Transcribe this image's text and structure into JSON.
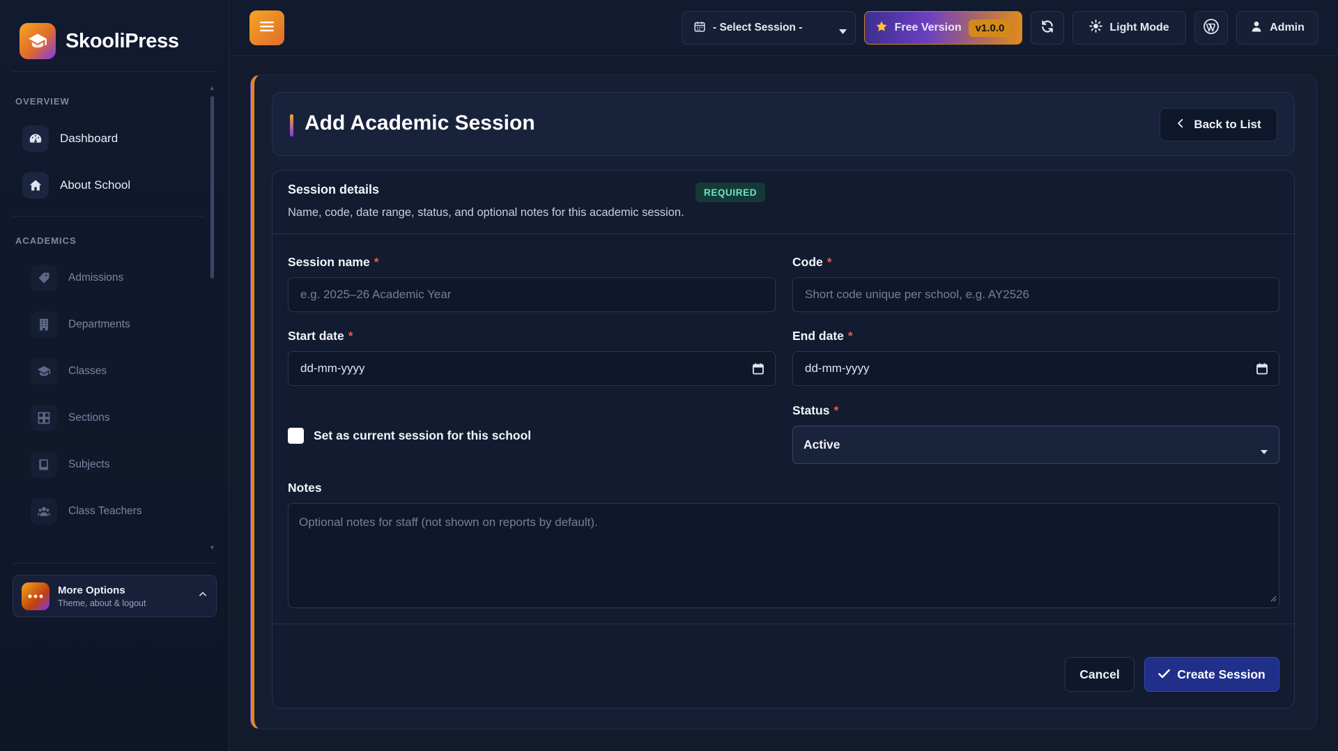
{
  "brand": {
    "name": "SkooliPress",
    "logo_icon": "graduation-cap-icon"
  },
  "sidebar": {
    "sections": [
      {
        "label": "OVERVIEW",
        "items": [
          {
            "label": "Dashboard",
            "icon": "gauge-icon"
          },
          {
            "label": "About School",
            "icon": "home-icon"
          }
        ]
      },
      {
        "label": "ACADEMICS",
        "items": [
          {
            "label": "Admissions",
            "icon": "tag-icon"
          },
          {
            "label": "Departments",
            "icon": "building-icon"
          },
          {
            "label": "Classes",
            "icon": "graduation-cap-icon"
          },
          {
            "label": "Sections",
            "icon": "grid-icon"
          },
          {
            "label": "Subjects",
            "icon": "book-icon"
          },
          {
            "label": "Class Teachers",
            "icon": "users-icon"
          }
        ]
      }
    ],
    "more_options": {
      "title": "More Options",
      "subtitle": "Theme, about & logout"
    }
  },
  "topbar": {
    "session_select": "- Select Session -",
    "free_version_label": "Free Version",
    "version": "v1.0.0",
    "light_mode_label": "Light Mode",
    "admin_label": "Admin"
  },
  "page": {
    "title": "Add Academic Session",
    "back_label": "Back to List"
  },
  "form": {
    "section_title": "Session details",
    "badge": "REQUIRED",
    "description": "Name, code, date range, status, and optional notes for this academic session.",
    "required_marker": "*",
    "session_name": {
      "label": "Session name",
      "placeholder": "e.g. 2025–26 Academic Year"
    },
    "code": {
      "label": "Code",
      "placeholder": "Short code unique per school, e.g. AY2526"
    },
    "start_date": {
      "label": "Start date",
      "value": "dd-mm-yyyy"
    },
    "end_date": {
      "label": "End date",
      "value": "dd-mm-yyyy"
    },
    "current_session_label": "Set as current session for this school",
    "status": {
      "label": "Status",
      "value": "Active"
    },
    "notes": {
      "label": "Notes",
      "placeholder": "Optional notes for staff (not shown on reports by default)."
    },
    "cancel_label": "Cancel",
    "submit_label": "Create Session"
  },
  "colors": {
    "accent_orange": "#f5a623",
    "accent_purple": "#7c3aed",
    "primary_button": "#1f2f8a",
    "required_red": "#f05252",
    "badge_green": "#6fe3c5"
  }
}
